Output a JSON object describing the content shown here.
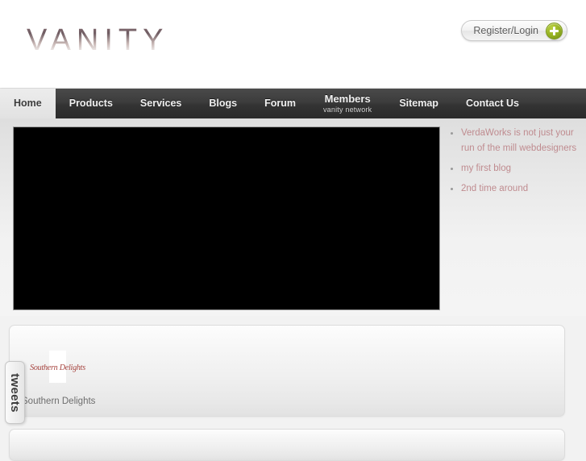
{
  "site": {
    "logo_text": "VANITY"
  },
  "header": {
    "register_login": {
      "label": "Register/Login",
      "icon": "plus-circle-icon"
    }
  },
  "nav": {
    "items": [
      {
        "label": "Home",
        "active": true,
        "caret": "",
        "sub": ""
      },
      {
        "label": "Products",
        "active": false,
        "caret": "⌄",
        "sub": ""
      },
      {
        "label": "Services",
        "active": false,
        "caret": "",
        "sub": ""
      },
      {
        "label": "Blogs",
        "active": false,
        "caret": "",
        "sub": ""
      },
      {
        "label": "Forum",
        "active": false,
        "caret": "",
        "sub": ""
      },
      {
        "label": "Members",
        "active": false,
        "caret": "",
        "sub": "vanity network"
      },
      {
        "label": "Sitemap",
        "active": false,
        "caret": "",
        "sub": ""
      },
      {
        "label": "Contact Us",
        "active": false,
        "caret": "",
        "sub": ""
      }
    ]
  },
  "main": {
    "stage": {
      "name": "flash-banner",
      "state": "blank"
    }
  },
  "sidebar": {
    "blog_items": [
      "VerdaWorks is not just your run of the mill webdesigners",
      "my first blog",
      "2nd time around"
    ]
  },
  "brands_panel": {
    "logo_text": "Southern Delights",
    "caption": "Southern Delights"
  },
  "tweets_tab": {
    "label": "tweets"
  },
  "colors": {
    "page_background": "#f2f2f2",
    "nav_background": "#3c3c3c",
    "nav_active_background": "#e2e2e2",
    "link_rose": "#bf8b8f",
    "accent_green": "#94b021",
    "brand_script": "#a6443f"
  }
}
